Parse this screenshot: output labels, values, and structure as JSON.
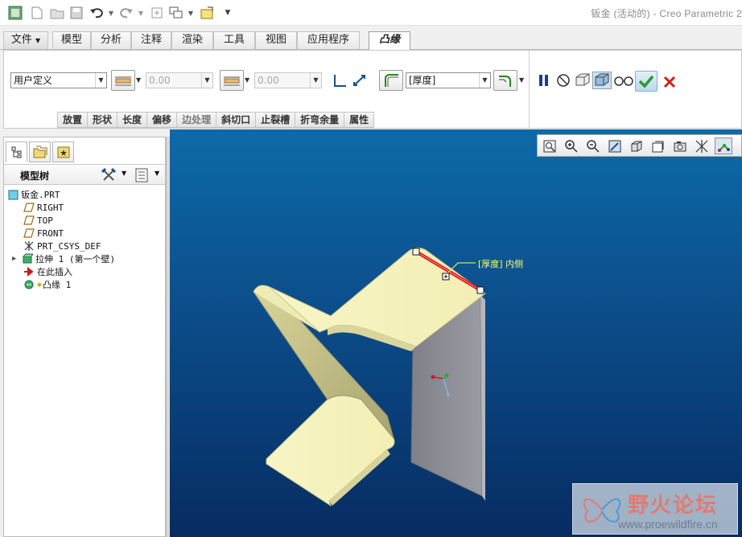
{
  "title": "钣金 (活动的) - Creo Parametric 2",
  "menu": {
    "file": "文件",
    "tabs": [
      "模型",
      "分析",
      "注释",
      "渲染",
      "工具",
      "视图",
      "应用程序"
    ],
    "active_tab": "凸缘"
  },
  "ribbon": {
    "shape_select": "用户定义",
    "length1_value": "0.00",
    "length2_value": "0.00",
    "thickness_select": "[厚度]",
    "subtabs": [
      "放置",
      "形状",
      "长度",
      "偏移",
      "边处理",
      "斜切口",
      "止裂槽",
      "折弯余量",
      "属性"
    ]
  },
  "model_tree": {
    "title": "模型树",
    "items": [
      "钣金.PRT",
      "RIGHT",
      "TOP",
      "FRONT",
      "PRT_CSYS_DEF",
      "拉伸 1 (第一个壁)",
      "在此插入",
      "凸缘 1"
    ]
  },
  "viewport": {
    "dimension_label": "[厚度] 内侧"
  },
  "watermark": {
    "text": "野火论坛",
    "url": "www.proewildfire.cn"
  },
  "colors": {
    "viewport_top": "#0d6aa9",
    "viewport_bottom": "#072c62",
    "part_face": "#f6f3bd",
    "flange_face": "#8c8c92",
    "edge_highlight": "#e01010",
    "confirm_green": "#2a9a2a",
    "cancel_red": "#d0201a"
  }
}
